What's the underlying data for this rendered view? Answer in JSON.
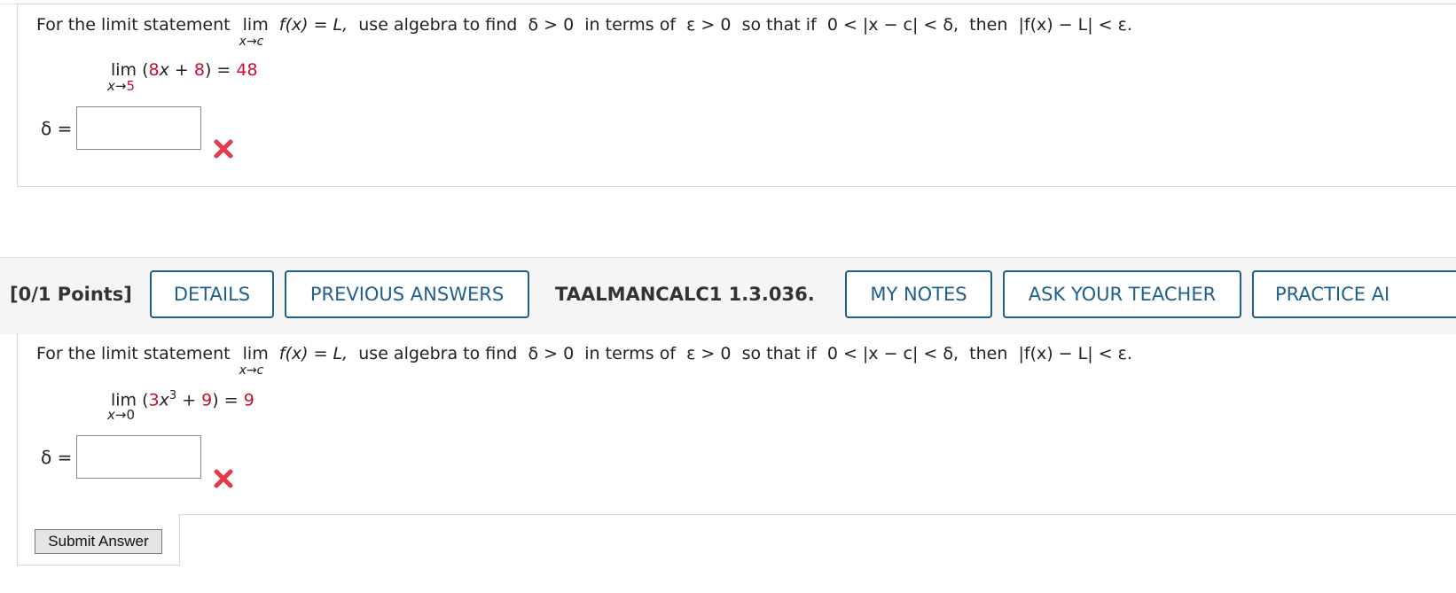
{
  "question1": {
    "intro": "For the limit statement",
    "lim": "lim",
    "lim_sub": "x→c",
    "fx_eq": "f(x) = L,",
    "rest_a": "use algebra to find",
    "delta_gt": "δ > 0",
    "rest_b": "in terms of",
    "eps_gt": "ε > 0",
    "rest_c": "so that if",
    "cond": "0 < |x − c| < δ,",
    "then": "then",
    "concl": "|f(x) − L| < ε.",
    "problem_lim": "lim",
    "problem_sub_var": "x→",
    "problem_sub_val": "5",
    "problem_open": "(",
    "problem_coef": "8",
    "problem_x": "x + ",
    "problem_const": "8",
    "problem_close": ") = ",
    "problem_value": "48",
    "delta_label": "δ =",
    "answer_value": "",
    "status": "incorrect"
  },
  "toolbar": {
    "points": "[0/1 Points]",
    "details": "DETAILS",
    "previous_answers": "PREVIOUS ANSWERS",
    "question_id": "TAALMANCALC1 1.3.036.",
    "my_notes": "MY NOTES",
    "ask_teacher": "ASK YOUR TEACHER",
    "practice": "PRACTICE AI"
  },
  "question2": {
    "intro": "For the limit statement",
    "lim": "lim",
    "lim_sub": "x→c",
    "fx_eq": "f(x) = L,",
    "rest_a": "use algebra to find",
    "delta_gt": "δ > 0",
    "rest_b": "in terms of",
    "eps_gt": "ε > 0",
    "rest_c": "so that if",
    "cond": "0 < |x − c| < δ,",
    "then": "then",
    "concl": "|f(x) − L| < ε.",
    "problem_lim": "lim",
    "problem_sub_var": "x→",
    "problem_sub_val": "0",
    "problem_open": "(",
    "problem_coef": "3",
    "problem_x": "x",
    "problem_exp": "3",
    "problem_plus": " + ",
    "problem_const": "9",
    "problem_close": ") = ",
    "problem_value": "9",
    "delta_label": "δ =",
    "answer_value": "",
    "status": "incorrect",
    "submit_label": "Submit Answer"
  },
  "colors": {
    "accent": "#1f5f8b",
    "highlight": "#c8102e",
    "error": "#e8394a"
  },
  "icons": {
    "status": "x-mark-icon"
  }
}
